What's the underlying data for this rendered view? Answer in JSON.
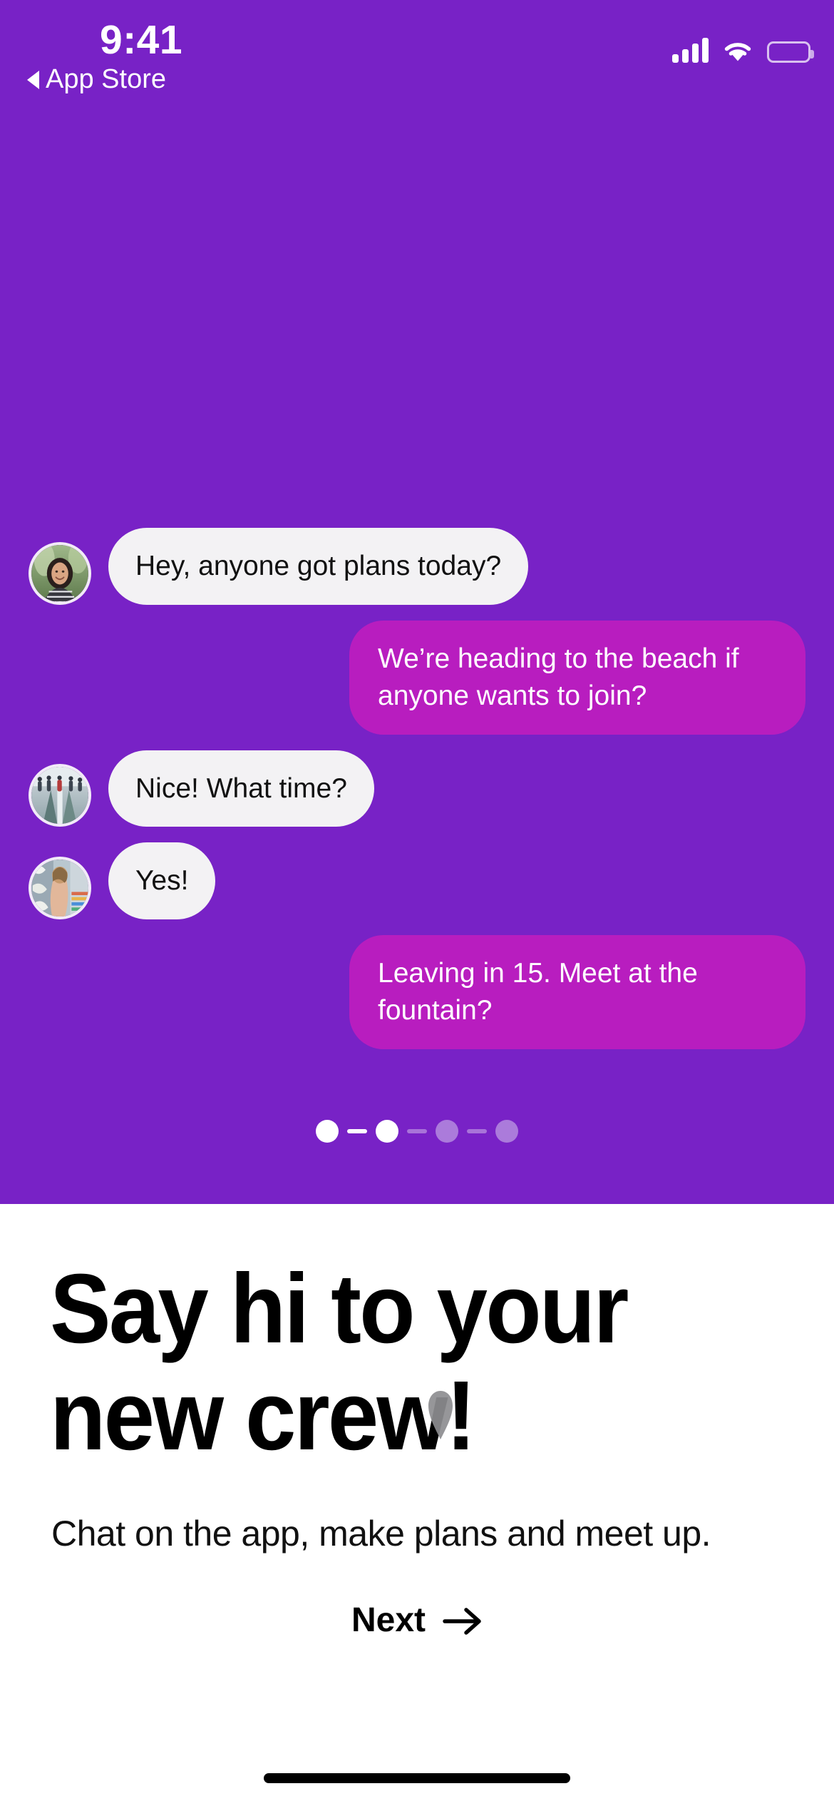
{
  "status_bar": {
    "time": "9:41",
    "back_label": "App Store",
    "cellular_bars": 4,
    "wifi": "wifi-full",
    "battery": "battery-full"
  },
  "theme": {
    "hero_purple": "#7822c6",
    "bubble_out_magenta": "#b81dbf",
    "bubble_in_gray": "#f3f2f4",
    "panel_white": "#ffffff",
    "text_black": "#000000",
    "dot_inactive": "#ab7bdb"
  },
  "chat": {
    "messages": [
      {
        "id": "m1",
        "direction": "incoming",
        "text": "Hey, anyone got plans today?",
        "avatar": "avatar-woman-smiling-outdoors"
      },
      {
        "id": "m2",
        "direction": "outgoing",
        "text": "We’re heading to the beach if anyone wants to join?",
        "avatar": null
      },
      {
        "id": "m3",
        "direction": "incoming",
        "text": "Nice! What time?",
        "avatar": "avatar-group-on-street"
      },
      {
        "id": "m4",
        "direction": "incoming",
        "text": "Yes!",
        "avatar": "avatar-person-mural-wall"
      },
      {
        "id": "m5",
        "direction": "outgoing",
        "text": "Leaving in 15. Meet at the fountain?",
        "avatar": null
      }
    ]
  },
  "progress": {
    "total_steps": 4,
    "current_step": 2,
    "steps": [
      {
        "index": 1,
        "state": "active"
      },
      {
        "index": 2,
        "state": "active"
      },
      {
        "index": 3,
        "state": "inactive"
      },
      {
        "index": 4,
        "state": "inactive"
      }
    ]
  },
  "panel": {
    "headline_line1": "Say hi to your",
    "headline_line2": "new crew!",
    "subtitle": "Chat on the app, make plans and meet up.",
    "next_label": "Next",
    "next_icon": "arrow-right-icon"
  },
  "system": {
    "home_indicator": "home-indicator",
    "cursor": "mouse-cursor"
  }
}
